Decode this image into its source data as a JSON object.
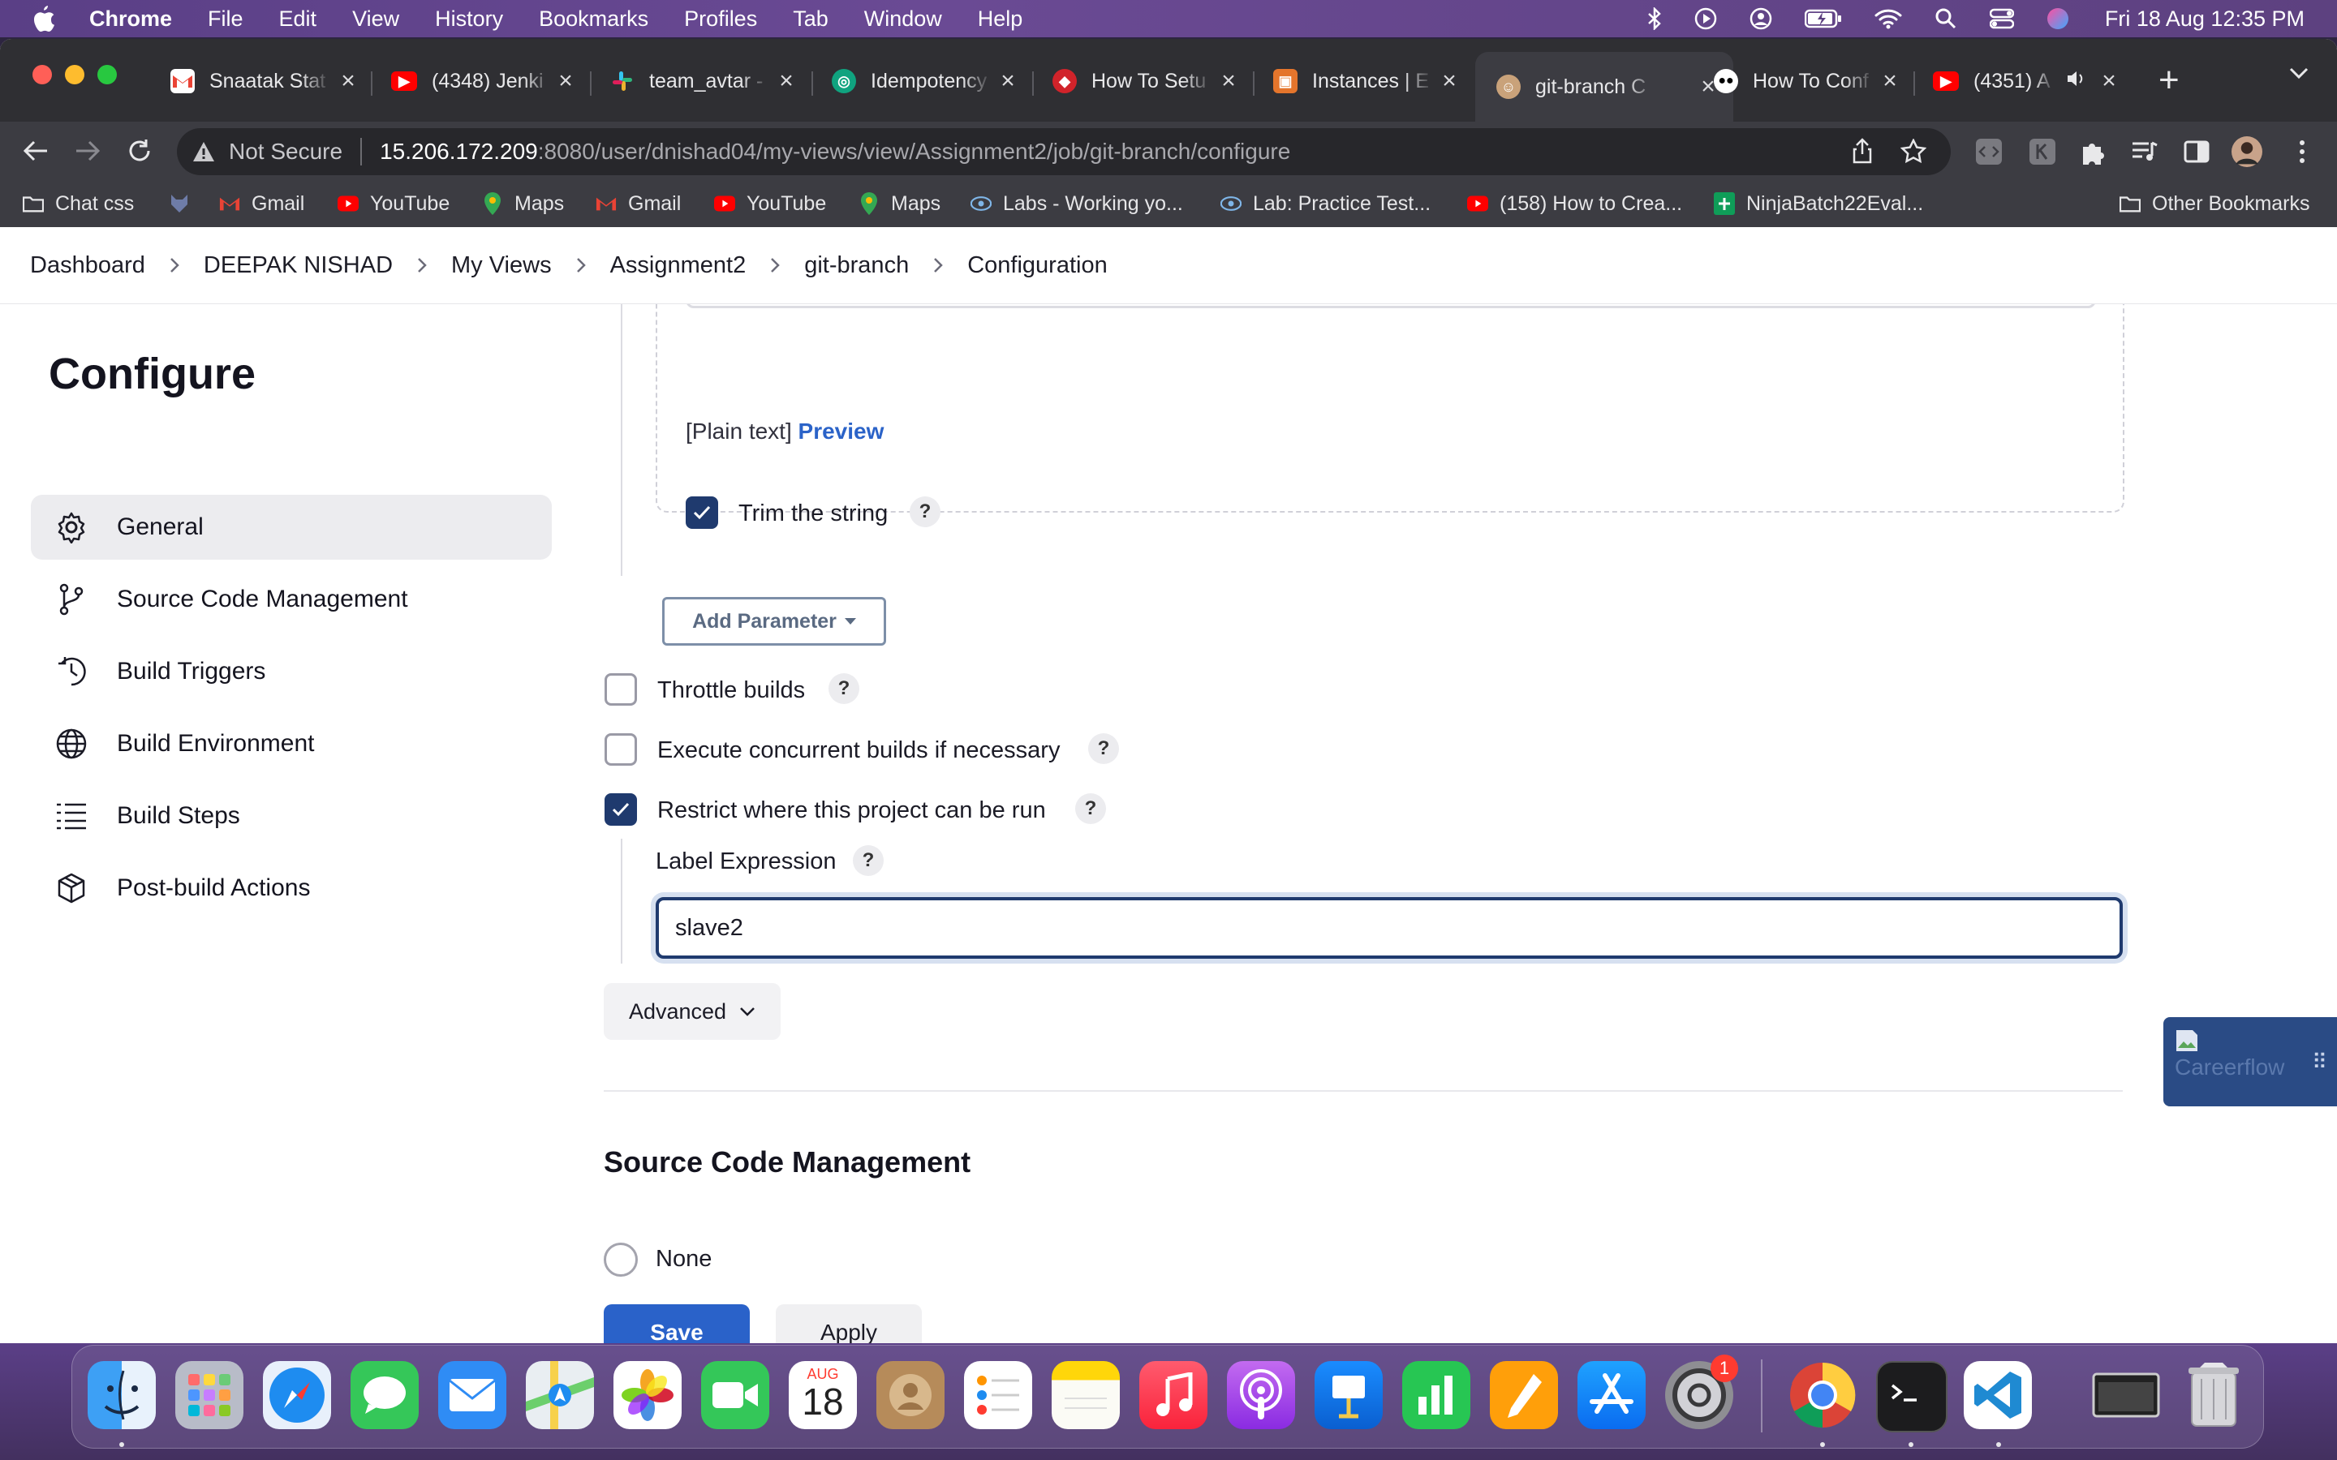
{
  "menubar": {
    "app": "Chrome",
    "items": [
      "File",
      "Edit",
      "View",
      "History",
      "Bookmarks",
      "Profiles",
      "Tab",
      "Window",
      "Help"
    ],
    "clock": "Fri 18 Aug  12:35 PM"
  },
  "tabs": [
    {
      "label": "Snaatak Stat",
      "color": "#ffffff",
      "glyph": "M"
    },
    {
      "label": "(4348) Jenki",
      "color": "#ff0000",
      "glyph": "▶"
    },
    {
      "label": "team_avtar - ",
      "color": "#e01e5a",
      "glyph": "#"
    },
    {
      "label": "Idempotency",
      "color": "#10a37f",
      "glyph": "◎"
    },
    {
      "label": "How To Setu",
      "color": "#d1232a",
      "glyph": "◆"
    },
    {
      "label": "Instances | E",
      "color": "#e4752c",
      "glyph": "▣"
    },
    {
      "label": "git-branch C",
      "color": "#c9a27a",
      "glyph": "☺"
    },
    {
      "label": "How To Conf",
      "color": "#000000",
      "glyph": "●●"
    },
    {
      "label": "(4351) A",
      "color": "#ff0000",
      "glyph": "▶"
    }
  ],
  "address": {
    "security": "Not Secure",
    "host": "15.206.172.209",
    "path": ":8080/user/dnishad04/my-views/view/Assignment2/job/git-branch/configure"
  },
  "bookmarks": [
    {
      "label": "Chat css",
      "icon": "folder-icon"
    },
    {
      "label": "",
      "icon": "wolf-icon"
    },
    {
      "label": "Gmail",
      "icon": "gmail-icon"
    },
    {
      "label": "YouTube",
      "icon": "youtube-icon"
    },
    {
      "label": "Maps",
      "icon": "maps-icon"
    },
    {
      "label": "Gmail",
      "icon": "gmail-icon"
    },
    {
      "label": "YouTube",
      "icon": "youtube-icon"
    },
    {
      "label": "Maps",
      "icon": "maps-icon"
    },
    {
      "label": "Labs - Working yo...",
      "icon": "labs-icon"
    },
    {
      "label": "Lab: Practice Test...",
      "icon": "labs-icon"
    },
    {
      "label": "(158) How to Crea...",
      "icon": "youtube-icon"
    },
    {
      "label": "NinjaBatch22Eval...",
      "icon": "sheets-icon"
    }
  ],
  "other_bookmarks": "Other Bookmarks",
  "breadcrumb": [
    "Dashboard",
    "DEEPAK NISHAD",
    "My Views",
    "Assignment2",
    "git-branch",
    "Configuration"
  ],
  "sidebar": {
    "title": "Configure",
    "items": [
      {
        "label": "General",
        "icon": "gear-icon",
        "selected": true
      },
      {
        "label": "Source Code Management",
        "icon": "branch-icon",
        "selected": false
      },
      {
        "label": "Build Triggers",
        "icon": "clock-icon",
        "selected": false
      },
      {
        "label": "Build Environment",
        "icon": "globe-icon",
        "selected": false
      },
      {
        "label": "Build Steps",
        "icon": "list-icon",
        "selected": false
      },
      {
        "label": "Post-build Actions",
        "icon": "package-icon",
        "selected": false
      }
    ]
  },
  "form": {
    "plain_text": "[Plain text]",
    "preview": "Preview",
    "trim_label": "Trim the string",
    "add_parameter": "Add Parameter",
    "throttle_label": "Throttle builds",
    "concurrent_label": "Execute concurrent builds if necessary",
    "restrict_label": "Restrict where this project can be run",
    "label_expression": "Label Expression",
    "label_value": "slave2",
    "advanced": "Advanced",
    "scm_title": "Source Code Management",
    "scm_none": "None",
    "help": "?"
  },
  "checks": {
    "trim": true,
    "throttle": false,
    "concurrent": false,
    "restrict": true
  },
  "buttons": {
    "save": "Save",
    "apply": "Apply"
  },
  "careerflow": "Careerflow",
  "dock": {
    "calendar_month": "AUG",
    "calendar_day": "18",
    "settings_badge": "1",
    "apps": [
      "finder",
      "launchpad",
      "safari",
      "messages",
      "mail",
      "maps",
      "photos",
      "facetime",
      "calendar",
      "contacts",
      "reminders",
      "notes",
      "music",
      "podcasts",
      "keynote",
      "numbers",
      "pages",
      "app-store",
      "system-settings",
      "chrome",
      "terminal",
      "vscode",
      "screen",
      "trash"
    ]
  },
  "colors": {
    "accent": "#2a62c9",
    "checked": "#1f3a6e"
  }
}
